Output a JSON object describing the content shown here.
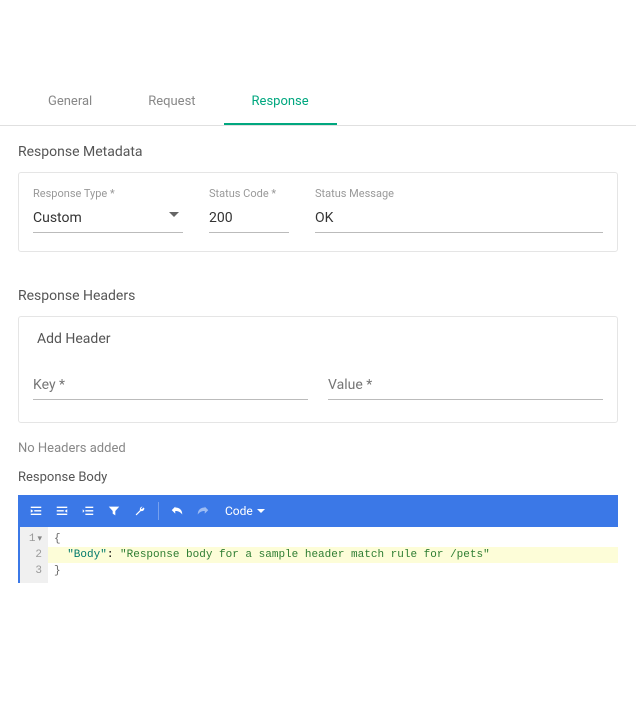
{
  "tabs": {
    "general": "General",
    "request": "Request",
    "response": "Response"
  },
  "metadata": {
    "title": "Response Metadata",
    "type_label": "Response Type *",
    "type_value": "Custom",
    "status_code_label": "Status Code *",
    "status_code_value": "200",
    "status_message_label": "Status Message",
    "status_message_value": "OK"
  },
  "headers": {
    "title": "Response Headers",
    "add_label": "Add Header",
    "key_placeholder": "Key *",
    "value_placeholder": "Value *",
    "empty": "No Headers added"
  },
  "body": {
    "title": "Response Body",
    "code_dropdown": "Code",
    "lines": {
      "l1": "1",
      "l2": "2",
      "l3": "3"
    },
    "json": {
      "open": "{",
      "key": "\"Body\"",
      "colon": ": ",
      "value": "\"Response body for a sample header match rule for /pets\"",
      "close": "}"
    }
  }
}
